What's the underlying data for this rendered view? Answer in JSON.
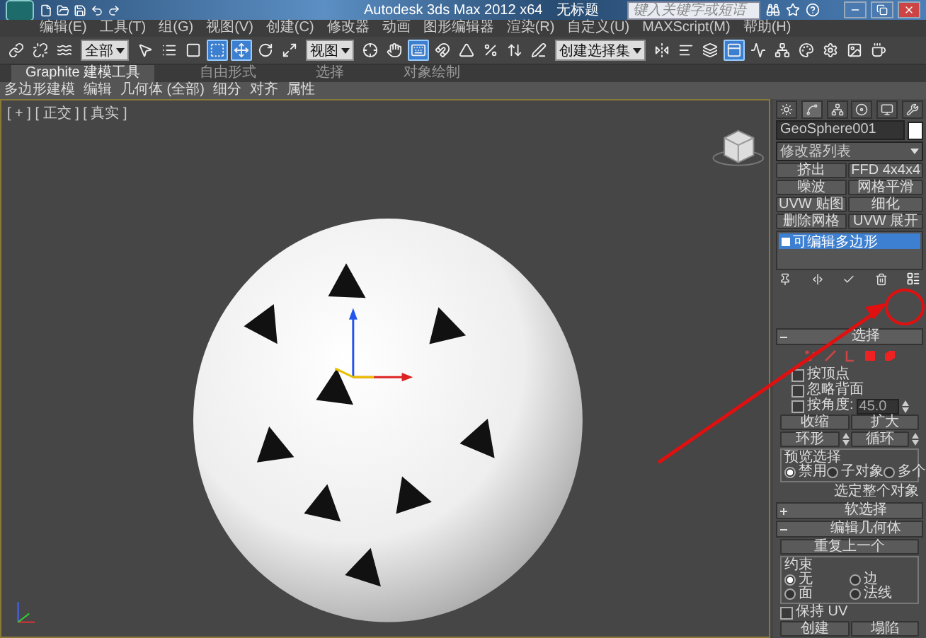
{
  "title_bar": {
    "title": "Autodesk 3ds Max  2012 x64",
    "document": "无标题",
    "search": {
      "placeholder": "键入关键字或短语"
    }
  },
  "menu": [
    "编辑(E)",
    "工具(T)",
    "组(G)",
    "视图(V)",
    "创建(C)",
    "修改器",
    "动画",
    "图形编辑器",
    "渲染(R)",
    "自定义(U)",
    "MAXScript(M)",
    "帮助(H)"
  ],
  "toolbar": [
    {
      "kind": "tool",
      "pressed": false
    },
    {
      "kind": "tool",
      "pressed": false
    },
    {
      "kind": "tool",
      "pressed": false
    },
    {
      "kind": "dropdown",
      "value": "全部"
    },
    {
      "kind": "tool",
      "pressed": false
    },
    {
      "kind": "tool",
      "pressed": false
    },
    {
      "kind": "tool",
      "pressed": false
    },
    {
      "kind": "tool",
      "pressed": true
    },
    {
      "kind": "tool",
      "pressed": true
    },
    {
      "kind": "tool",
      "pressed": false
    },
    {
      "kind": "tool",
      "pressed": false
    },
    {
      "kind": "dropdown",
      "value": "视图"
    },
    {
      "kind": "tool",
      "pressed": false
    },
    {
      "kind": "tool",
      "pressed": false
    },
    {
      "kind": "tool",
      "pressed": true
    },
    {
      "kind": "tool",
      "pressed": false
    },
    {
      "kind": "tool",
      "pressed": false
    },
    {
      "kind": "tool",
      "pressed": false
    },
    {
      "kind": "tool",
      "pressed": false
    },
    {
      "kind": "tool",
      "pressed": false
    },
    {
      "kind": "dropdown",
      "value": "创建选择集"
    },
    {
      "kind": "tool",
      "pressed": false
    },
    {
      "kind": "tool",
      "pressed": false
    },
    {
      "kind": "tool",
      "pressed": false
    },
    {
      "kind": "tool",
      "pressed": true
    },
    {
      "kind": "tool",
      "pressed": false
    },
    {
      "kind": "tool",
      "pressed": false
    },
    {
      "kind": "tool",
      "pressed": false
    },
    {
      "kind": "tool",
      "pressed": false
    },
    {
      "kind": "tool",
      "pressed": false
    },
    {
      "kind": "tool",
      "pressed": false
    }
  ],
  "ribbon": {
    "tabs": [
      {
        "label": "Graphite 建模工具",
        "selected": true
      },
      {
        "label": "自由形式",
        "selected": false
      },
      {
        "label": "选择",
        "selected": false
      },
      {
        "label": "对象绘制",
        "selected": false
      }
    ],
    "panels": [
      "多边形建模",
      "编辑",
      "几何体 (全部)",
      "细分",
      "对齐",
      "属性"
    ]
  },
  "viewport": {
    "label": "[ + ] [ 正交 ] [ 真实 ]"
  },
  "command_panel": {
    "tabs": [
      {
        "selected": false
      },
      {
        "selected": true
      },
      {
        "selected": false
      },
      {
        "selected": false
      },
      {
        "selected": false
      },
      {
        "selected": false
      }
    ],
    "object_name": "GeoSphere001",
    "modifier_list": "修改器列表",
    "modifier_buttons": [
      "挤出",
      "FFD 4x4x4",
      "噪波",
      "网格平滑",
      "UVW 贴图",
      "细化",
      "删除网格",
      "UVW 展开"
    ],
    "stack": [
      {
        "label": "可编辑多边形",
        "selected": true
      }
    ],
    "rollouts": [
      {
        "kind": "selection",
        "title": "选择",
        "expanded": true,
        "checkboxes": [
          {
            "label": "按顶点",
            "checked": false
          },
          {
            "label": "忽略背面",
            "checked": false
          },
          {
            "label": "按角度:",
            "checked": false,
            "value": "45.0"
          }
        ],
        "buttons": [
          "收缩",
          "扩大"
        ],
        "spin_buttons": [
          "环形",
          "循环"
        ],
        "group": {
          "title": "预览选择",
          "options": [
            {
              "label": "禁用",
              "selected": true
            },
            {
              "label": "子对象",
              "selected": false
            },
            {
              "label": "多个",
              "selected": false
            }
          ]
        },
        "note": "选定整个对象"
      },
      {
        "kind": "soft",
        "title": "软选择",
        "expanded": false
      },
      {
        "kind": "edit_geometry",
        "title": "编辑几何体",
        "expanded": true,
        "button": "重复上一个",
        "group": {
          "title": "约束",
          "options": [
            {
              "label": "无",
              "selected": true
            },
            {
              "label": "边",
              "selected": false
            },
            {
              "label": "面",
              "selected": false
            },
            {
              "label": "法线",
              "selected": false
            }
          ]
        },
        "checkbox": {
          "label": "保持 UV",
          "checked": false
        },
        "buttons": [
          "创建",
          "塌陷"
        ]
      }
    ]
  }
}
